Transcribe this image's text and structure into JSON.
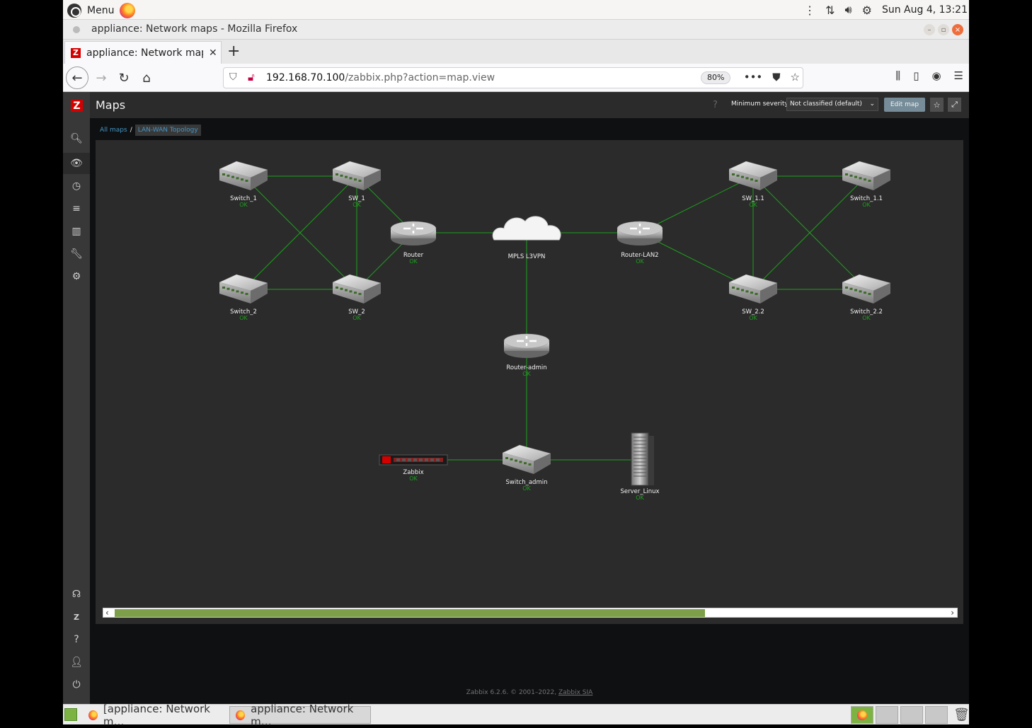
{
  "os": {
    "menu_label": "Menu",
    "clock": "Sun Aug  4, 13:21"
  },
  "window": {
    "title": "appliance: Network maps - Mozilla Firefox"
  },
  "browser": {
    "tab_title": "appliance: Network maps",
    "url_host": "192.168.70.100",
    "url_path": "/zabbix.php?action=map.view",
    "zoom": "80%"
  },
  "zabbix": {
    "page_title": "Maps",
    "help": "?",
    "severity_label": "Minimum severity",
    "severity_value": "Not classified (default)",
    "edit_map_label": "Edit map",
    "breadcrumb": {
      "all_maps": "All maps",
      "separator": "/",
      "current": "LAN-WAN Topology"
    },
    "footer_text": "Zabbix 6.2.6. © 2001–2022, ",
    "footer_link": "Zabbix SIA",
    "sidebar_icons": [
      "search-icon",
      "monitoring-eye-icon",
      "services-stopwatch-icon",
      "inventory-list-icon",
      "reports-chart-icon",
      "configuration-wrench-icon",
      "administration-gear-icon",
      "support-headset-icon",
      "zabbix-share-icon",
      "help-icon",
      "user-settings-icon",
      "sign-out-icon"
    ]
  },
  "map": {
    "link_color": "#1ea01e",
    "status_color": "#1ea01e",
    "elements": [
      {
        "id": "switch_1",
        "label": "Switch_1",
        "status": "OK",
        "type": "switch"
      },
      {
        "id": "sw_1",
        "label": "SW_1",
        "status": "OK",
        "type": "switch"
      },
      {
        "id": "switch_2",
        "label": "Switch_2",
        "status": "OK",
        "type": "switch"
      },
      {
        "id": "sw_2",
        "label": "SW_2",
        "status": "OK",
        "type": "switch"
      },
      {
        "id": "router",
        "label": "Router",
        "status": "OK",
        "type": "router"
      },
      {
        "id": "mpls",
        "label": "MPLS L3VPN",
        "status": "",
        "type": "cloud"
      },
      {
        "id": "router_lan2",
        "label": "Router-LAN2",
        "status": "OK",
        "type": "router"
      },
      {
        "id": "sw_1_1",
        "label": "SW_1.1",
        "status": "OK",
        "type": "switch"
      },
      {
        "id": "switch_1_1",
        "label": "Switch_1.1",
        "status": "OK",
        "type": "switch"
      },
      {
        "id": "sw_2_2",
        "label": "SW_2.2",
        "status": "OK",
        "type": "switch"
      },
      {
        "id": "switch_2_2",
        "label": "Switch_2.2",
        "status": "OK",
        "type": "switch"
      },
      {
        "id": "router_admin",
        "label": "Router-admin",
        "status": "OK",
        "type": "router"
      },
      {
        "id": "zabbix",
        "label": "Zabbix",
        "status": "OK",
        "type": "appliance"
      },
      {
        "id": "switch_admin",
        "label": "Switch_admin",
        "status": "OK",
        "type": "switch"
      },
      {
        "id": "server_linux",
        "label": "Server_Linux",
        "status": "OK",
        "type": "server"
      }
    ],
    "links": [
      [
        "switch_1",
        "sw_1"
      ],
      [
        "switch_1",
        "sw_2"
      ],
      [
        "sw_1",
        "switch_2"
      ],
      [
        "sw_1",
        "sw_2"
      ],
      [
        "switch_2",
        "sw_2"
      ],
      [
        "sw_1",
        "router"
      ],
      [
        "sw_2",
        "router"
      ],
      [
        "router",
        "mpls"
      ],
      [
        "mpls",
        "router_lan2"
      ],
      [
        "mpls",
        "router_admin"
      ],
      [
        "router_lan2",
        "sw_1_1"
      ],
      [
        "router_lan2",
        "sw_2_2"
      ],
      [
        "sw_1_1",
        "switch_1_1"
      ],
      [
        "sw_1_1",
        "sw_2_2"
      ],
      [
        "sw_1_1",
        "switch_2_2"
      ],
      [
        "switch_1_1",
        "sw_2_2"
      ],
      [
        "sw_2_2",
        "switch_2_2"
      ],
      [
        "router_admin",
        "switch_admin"
      ],
      [
        "zabbix",
        "switch_admin"
      ],
      [
        "switch_admin",
        "server_linux"
      ]
    ]
  },
  "taskbar": {
    "item_1": "[appliance: Network m…",
    "item_2": "appliance: Network m…"
  }
}
